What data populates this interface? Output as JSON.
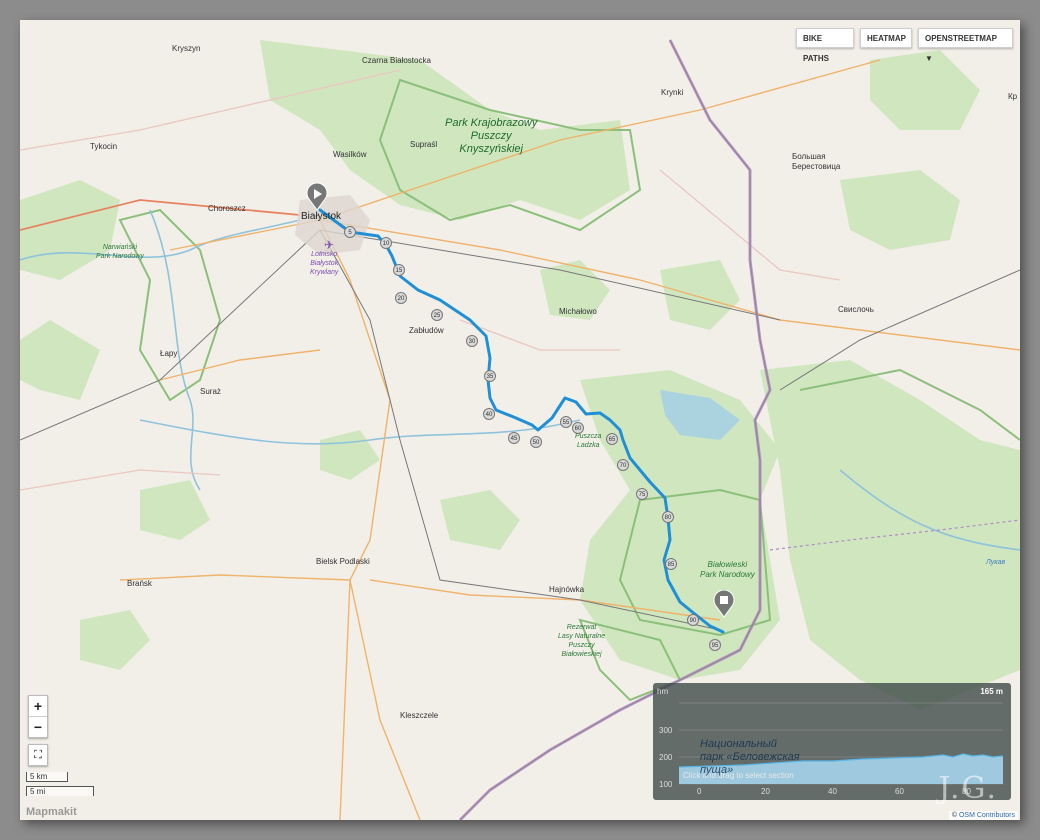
{
  "map": {
    "layers": {
      "bike_paths": "BIKE PATHS",
      "heatmap": "HEATMAP",
      "base": "OPENSTREETMAP ▼"
    },
    "places": [
      {
        "id": "kryszyn",
        "text": "Kryszyn"
      },
      {
        "id": "czarna",
        "text": "Czarna Białostocka"
      },
      {
        "id": "krynki",
        "text": "Krynki"
      },
      {
        "id": "tykocin",
        "text": "Tykocin"
      },
      {
        "id": "wasilkow",
        "text": "Wasilków"
      },
      {
        "id": "suprasl",
        "text": "Supraśl"
      },
      {
        "id": "bolshaya",
        "text": "Большая\nБерестовица"
      },
      {
        "id": "choroszcz",
        "text": "Choroszcz"
      },
      {
        "id": "bialystok",
        "text": "Białystok"
      },
      {
        "id": "zabludow",
        "text": "Zabłudów"
      },
      {
        "id": "michalowo",
        "text": "Michałowo"
      },
      {
        "id": "svisloch",
        "text": "Свислочь"
      },
      {
        "id": "lapy",
        "text": "Łapy"
      },
      {
        "id": "suraz",
        "text": "Suraż"
      },
      {
        "id": "bielsk",
        "text": "Bielsk Podlaski"
      },
      {
        "id": "bransk",
        "text": "Brańsk"
      },
      {
        "id": "hajnowka",
        "text": "Hajnówka"
      },
      {
        "id": "kleszczele",
        "text": "Kleszczele"
      },
      {
        "id": "kr",
        "text": "Кр"
      }
    ],
    "parks": [
      {
        "id": "knyszyn",
        "text": "Park Krajobrazowy\nPuszczy\nKnyszyńskiej"
      },
      {
        "id": "narwianski",
        "text": "Narwiański\nPark Narodowy"
      },
      {
        "id": "puszcza_ladzka",
        "text": "Puszcza\nLadzka"
      },
      {
        "id": "bpn",
        "text": "Białowieski\nPark Narodowy"
      },
      {
        "id": "rezerwat",
        "text": "Rezerwat\nLasy Naturalne\nPuszczy\nBiałowieskiej"
      }
    ],
    "airport": "Lotnisko\nBiałystok\nKrywlany",
    "water": "Лукав",
    "route": {
      "color": "#1f8fd6",
      "km_markers": [
        "5",
        "10",
        "15",
        "20",
        "25",
        "30",
        "35",
        "40",
        "45",
        "50",
        "55",
        "60",
        "65",
        "70",
        "75",
        "80",
        "85",
        "90",
        "95"
      ],
      "start_icon": "play-icon",
      "end_icon": "stop-icon"
    },
    "controls": {
      "zoom_in": "+",
      "zoom_out": "−",
      "fullscreen": "⛶"
    },
    "scale": {
      "km": "5 km",
      "mi": "5 mi"
    },
    "brand": "Mapmakit",
    "attribution": {
      "prefix": "©",
      "link": "OSM Contributors"
    }
  },
  "elevation": {
    "unit": "hm",
    "total": "165 m",
    "y_ticks": [
      "300",
      "200",
      "100"
    ],
    "x_ticks": [
      "0",
      "20",
      "40",
      "60",
      "80"
    ],
    "hint": "Click and drag to select section",
    "overlay_text": "Национальный\nпарк «Беловежская\nпуща»"
  },
  "watermark": "J.G."
}
